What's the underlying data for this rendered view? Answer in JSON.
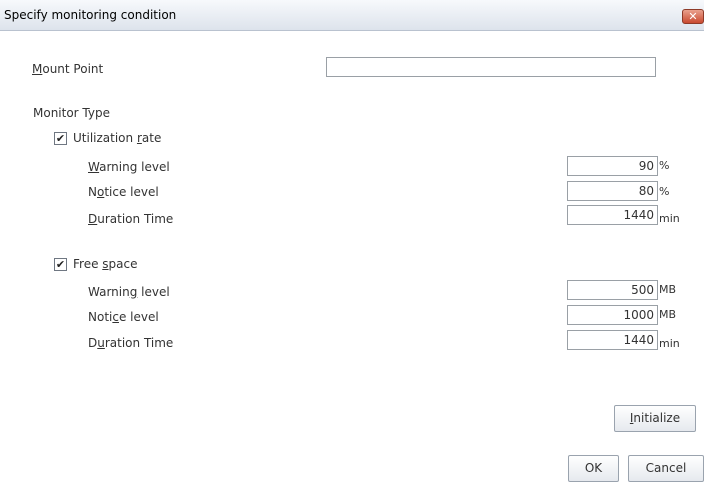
{
  "window": {
    "title": "Specify monitoring condition",
    "close_icon": "close-icon"
  },
  "mount_point": {
    "label_underlined": "M",
    "label_rest": "ount Point",
    "value": ""
  },
  "monitor_type": {
    "heading": "Monitor Type",
    "utilization": {
      "checked": true,
      "label_pre": "Utilization ",
      "label_underlined": "r",
      "label_post": "ate",
      "warning": {
        "pre": "",
        "u": "W",
        "post": "arning level",
        "value": "90",
        "unit": "%"
      },
      "notice": {
        "pre": "N",
        "u": "o",
        "post": "tice level",
        "value": "80",
        "unit": "%"
      },
      "duration": {
        "pre": "",
        "u": "D",
        "post": "uration Time",
        "value": "1440",
        "unit": "min"
      }
    },
    "free_space": {
      "checked": true,
      "label_pre": "Free ",
      "label_underlined": "s",
      "label_post": "pace",
      "warning": {
        "pre": "Warnin",
        "u": "g",
        "post": " level",
        "value": "500",
        "unit": "MB"
      },
      "notice": {
        "pre": "Noti",
        "u": "c",
        "post": "e level",
        "value": "1000",
        "unit": "MB"
      },
      "duration": {
        "pre": "D",
        "u": "u",
        "post": "ration Time",
        "value": "1440",
        "unit": "min"
      }
    }
  },
  "buttons": {
    "initialize_u": "I",
    "initialize_rest": "nitialize",
    "ok": "OK",
    "cancel": "Cancel"
  }
}
